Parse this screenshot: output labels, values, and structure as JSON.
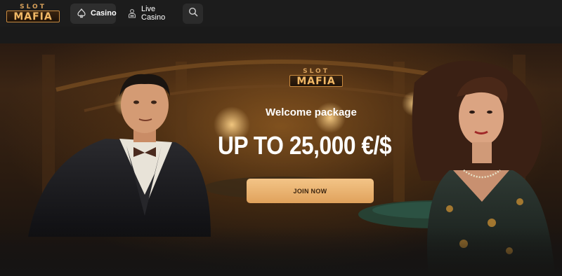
{
  "header": {
    "logo": {
      "top": "SLOT",
      "main": "MAFIA"
    },
    "nav": [
      {
        "label": "Casino",
        "icon": "spade-icon"
      },
      {
        "label": "Live Casino",
        "icon": "dealer-icon"
      }
    ],
    "search_icon": "search-icon"
  },
  "hero": {
    "logo": {
      "top": "SLOT",
      "main": "MAFIA"
    },
    "subtitle": "Welcome package",
    "headline": "UP TO 25,000 €/$",
    "cta_label": "JOIN NOW"
  },
  "colors": {
    "accent": "#e0a25c",
    "background": "#1a1a1a",
    "nav_active": "#2e2e2e"
  }
}
